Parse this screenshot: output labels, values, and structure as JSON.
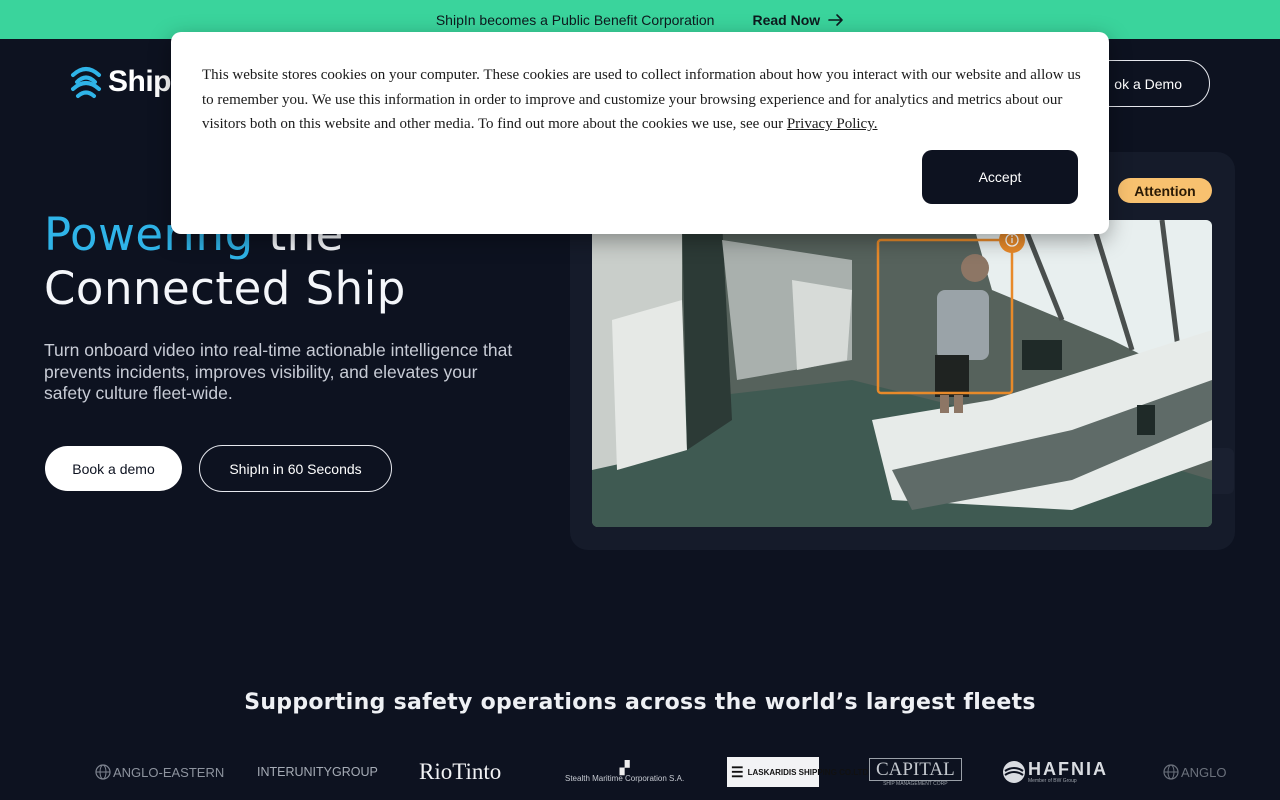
{
  "announcement": {
    "text": "ShipIn becomes a Public Benefit Corporation",
    "link_label": "Read Now"
  },
  "header": {
    "logo_text": "Ship",
    "book_demo_label": "ok a Demo"
  },
  "hero": {
    "title_accent": "Powering",
    "title_rest": " the",
    "title_line2": "Connected Ship",
    "subtitle": "Turn onboard video into real-time actionable intelligence that prevents incidents, improves visibility, and elevates your safety culture fleet-wide.",
    "primary_button": "Book a demo",
    "secondary_button": "ShipIn in 60 Seconds"
  },
  "video_card": {
    "badge": "Attention",
    "badge_color": "#f8c16f",
    "detection_color": "#e88a2a"
  },
  "fleets": {
    "title": "Supporting safety operations across the world’s largest fleets",
    "logos": [
      "ANGLO-EASTERN",
      "INTERUNITYGROUP",
      "RioTinto",
      "Stealth Maritime Corporation S.A.",
      "LASKARIDIS SHIPPING CO.LTD.",
      "CAPITAL",
      "SHIP MANAGEMENT CORP",
      "HAFNIA",
      "Member of BW Group",
      "ANGLO"
    ]
  },
  "cookie_banner": {
    "text": "This website stores cookies on your computer. These cookies are used to collect information about how you interact with our website and allow us to remember you. We use this information in order to improve and customize your browsing experience and for analytics and metrics about our visitors both on this website and other media. To find out more about the cookies we use, see our",
    "policy_link": "Privacy Policy.",
    "accept_label": "Accept"
  },
  "colors": {
    "background": "#0d1220",
    "announcement_bar": "#3ad49c",
    "accent_blue": "#2fb4e8"
  }
}
